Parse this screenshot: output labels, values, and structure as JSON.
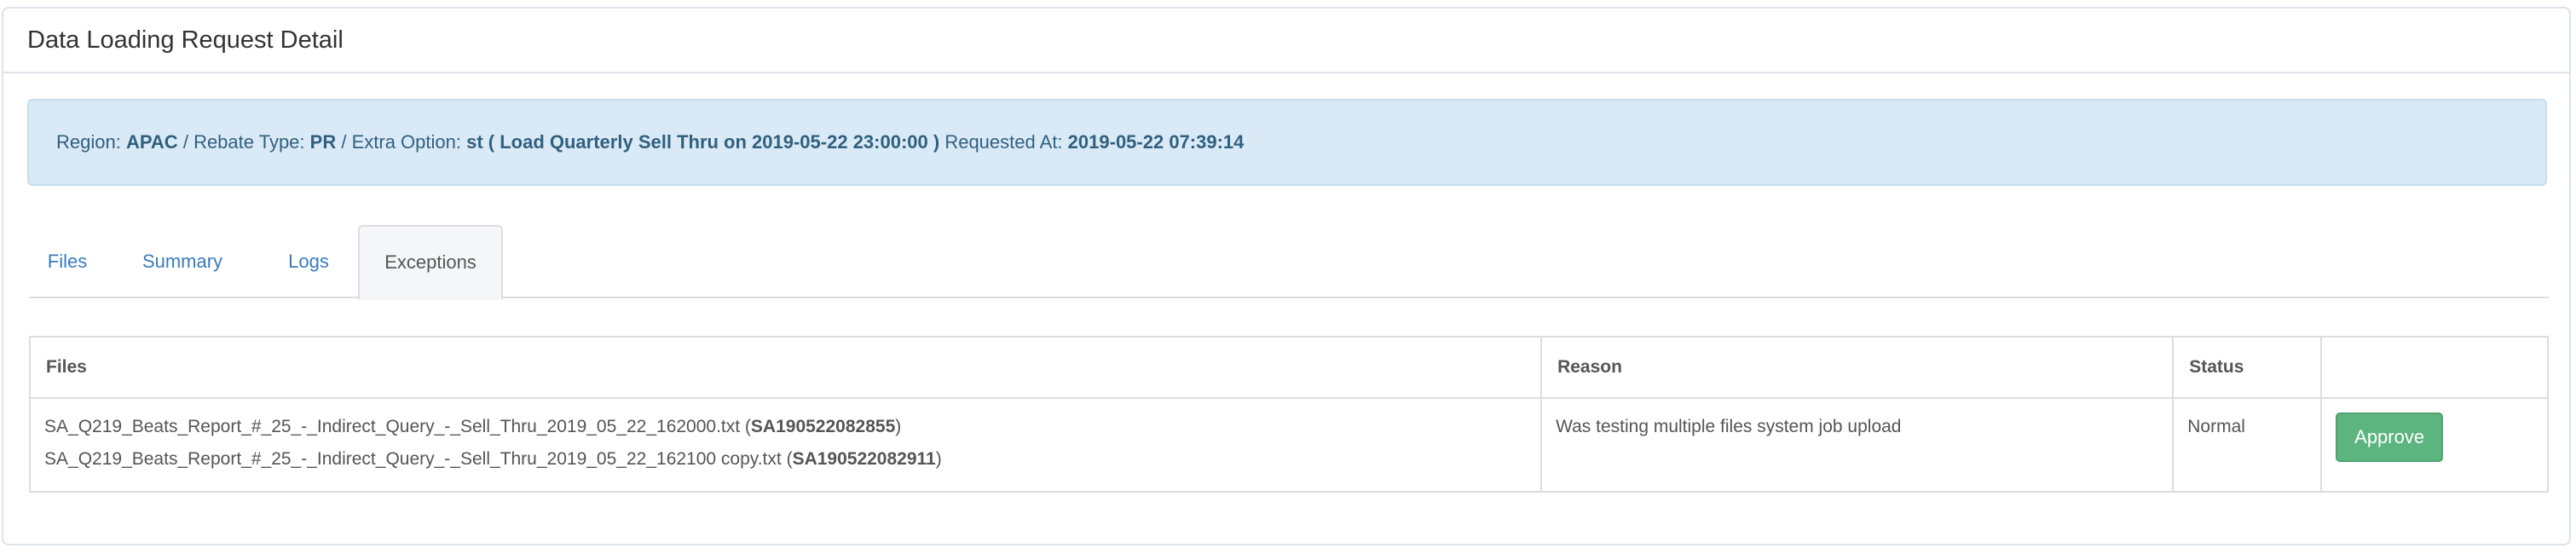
{
  "panel": {
    "title": "Data Loading Request Detail"
  },
  "info": {
    "region_label": "Region:",
    "region_value": "APAC",
    "sep1": "/",
    "rebate_label": "Rebate Type:",
    "rebate_value": "PR",
    "sep2": "/",
    "extra_label": "Extra Option:",
    "extra_value": "st ( Load Quarterly Sell Thru on 2019-05-22 23:00:00 )",
    "requested_label": "Requested At:",
    "requested_value": "2019-05-22 07:39:14"
  },
  "tabs": [
    {
      "label": "Files",
      "active": false
    },
    {
      "label": "Summary",
      "active": false
    },
    {
      "label": "Logs",
      "active": false
    },
    {
      "label": "Exceptions",
      "active": true
    }
  ],
  "table": {
    "headers": [
      "Files",
      "Reason",
      "Status",
      ""
    ],
    "rows": [
      {
        "files": [
          {
            "name": "SA_Q219_Beats_Report_#_25_-_Indirect_Query_-_Sell_Thru_2019_05_22_162000.txt",
            "id": "SA190522082855"
          },
          {
            "name": "SA_Q219_Beats_Report_#_25_-_Indirect_Query_-_Sell_Thru_2019_05_22_162100 copy.txt",
            "id": "SA190522082911"
          }
        ],
        "reason": "Was testing multiple files system job upload",
        "status": "Normal",
        "action_label": "Approve"
      }
    ]
  },
  "colors": {
    "info_bg": "#d9eaf6",
    "info_text": "#31607f",
    "link": "#3a7bbd",
    "approve": "#5cb47f"
  }
}
